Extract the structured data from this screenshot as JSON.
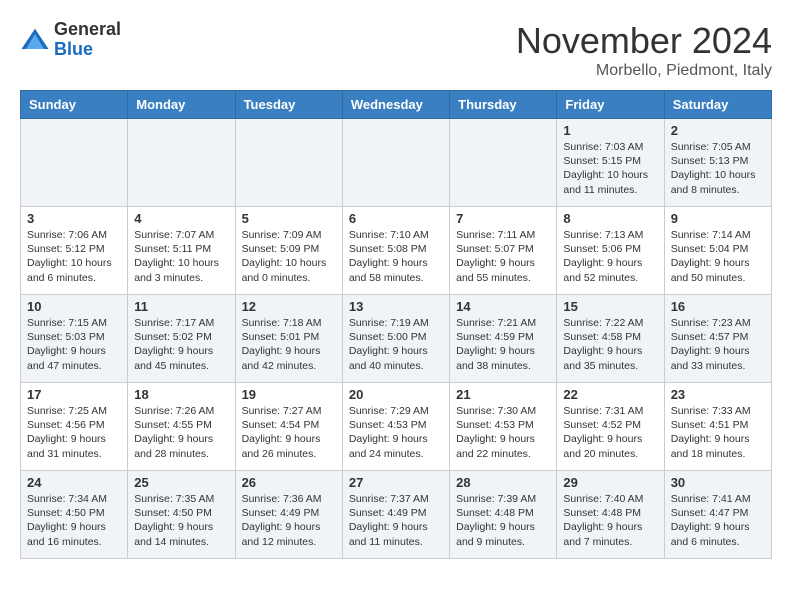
{
  "header": {
    "logo_line1": "General",
    "logo_line2": "Blue",
    "month_title": "November 2024",
    "location": "Morbello, Piedmont, Italy"
  },
  "weekdays": [
    "Sunday",
    "Monday",
    "Tuesday",
    "Wednesday",
    "Thursday",
    "Friday",
    "Saturday"
  ],
  "weeks": [
    [
      {
        "day": "",
        "info": ""
      },
      {
        "day": "",
        "info": ""
      },
      {
        "day": "",
        "info": ""
      },
      {
        "day": "",
        "info": ""
      },
      {
        "day": "",
        "info": ""
      },
      {
        "day": "1",
        "info": "Sunrise: 7:03 AM\nSunset: 5:15 PM\nDaylight: 10 hours and 11 minutes."
      },
      {
        "day": "2",
        "info": "Sunrise: 7:05 AM\nSunset: 5:13 PM\nDaylight: 10 hours and 8 minutes."
      }
    ],
    [
      {
        "day": "3",
        "info": "Sunrise: 7:06 AM\nSunset: 5:12 PM\nDaylight: 10 hours and 6 minutes."
      },
      {
        "day": "4",
        "info": "Sunrise: 7:07 AM\nSunset: 5:11 PM\nDaylight: 10 hours and 3 minutes."
      },
      {
        "day": "5",
        "info": "Sunrise: 7:09 AM\nSunset: 5:09 PM\nDaylight: 10 hours and 0 minutes."
      },
      {
        "day": "6",
        "info": "Sunrise: 7:10 AM\nSunset: 5:08 PM\nDaylight: 9 hours and 58 minutes."
      },
      {
        "day": "7",
        "info": "Sunrise: 7:11 AM\nSunset: 5:07 PM\nDaylight: 9 hours and 55 minutes."
      },
      {
        "day": "8",
        "info": "Sunrise: 7:13 AM\nSunset: 5:06 PM\nDaylight: 9 hours and 52 minutes."
      },
      {
        "day": "9",
        "info": "Sunrise: 7:14 AM\nSunset: 5:04 PM\nDaylight: 9 hours and 50 minutes."
      }
    ],
    [
      {
        "day": "10",
        "info": "Sunrise: 7:15 AM\nSunset: 5:03 PM\nDaylight: 9 hours and 47 minutes."
      },
      {
        "day": "11",
        "info": "Sunrise: 7:17 AM\nSunset: 5:02 PM\nDaylight: 9 hours and 45 minutes."
      },
      {
        "day": "12",
        "info": "Sunrise: 7:18 AM\nSunset: 5:01 PM\nDaylight: 9 hours and 42 minutes."
      },
      {
        "day": "13",
        "info": "Sunrise: 7:19 AM\nSunset: 5:00 PM\nDaylight: 9 hours and 40 minutes."
      },
      {
        "day": "14",
        "info": "Sunrise: 7:21 AM\nSunset: 4:59 PM\nDaylight: 9 hours and 38 minutes."
      },
      {
        "day": "15",
        "info": "Sunrise: 7:22 AM\nSunset: 4:58 PM\nDaylight: 9 hours and 35 minutes."
      },
      {
        "day": "16",
        "info": "Sunrise: 7:23 AM\nSunset: 4:57 PM\nDaylight: 9 hours and 33 minutes."
      }
    ],
    [
      {
        "day": "17",
        "info": "Sunrise: 7:25 AM\nSunset: 4:56 PM\nDaylight: 9 hours and 31 minutes."
      },
      {
        "day": "18",
        "info": "Sunrise: 7:26 AM\nSunset: 4:55 PM\nDaylight: 9 hours and 28 minutes."
      },
      {
        "day": "19",
        "info": "Sunrise: 7:27 AM\nSunset: 4:54 PM\nDaylight: 9 hours and 26 minutes."
      },
      {
        "day": "20",
        "info": "Sunrise: 7:29 AM\nSunset: 4:53 PM\nDaylight: 9 hours and 24 minutes."
      },
      {
        "day": "21",
        "info": "Sunrise: 7:30 AM\nSunset: 4:53 PM\nDaylight: 9 hours and 22 minutes."
      },
      {
        "day": "22",
        "info": "Sunrise: 7:31 AM\nSunset: 4:52 PM\nDaylight: 9 hours and 20 minutes."
      },
      {
        "day": "23",
        "info": "Sunrise: 7:33 AM\nSunset: 4:51 PM\nDaylight: 9 hours and 18 minutes."
      }
    ],
    [
      {
        "day": "24",
        "info": "Sunrise: 7:34 AM\nSunset: 4:50 PM\nDaylight: 9 hours and 16 minutes."
      },
      {
        "day": "25",
        "info": "Sunrise: 7:35 AM\nSunset: 4:50 PM\nDaylight: 9 hours and 14 minutes."
      },
      {
        "day": "26",
        "info": "Sunrise: 7:36 AM\nSunset: 4:49 PM\nDaylight: 9 hours and 12 minutes."
      },
      {
        "day": "27",
        "info": "Sunrise: 7:37 AM\nSunset: 4:49 PM\nDaylight: 9 hours and 11 minutes."
      },
      {
        "day": "28",
        "info": "Sunrise: 7:39 AM\nSunset: 4:48 PM\nDaylight: 9 hours and 9 minutes."
      },
      {
        "day": "29",
        "info": "Sunrise: 7:40 AM\nSunset: 4:48 PM\nDaylight: 9 hours and 7 minutes."
      },
      {
        "day": "30",
        "info": "Sunrise: 7:41 AM\nSunset: 4:47 PM\nDaylight: 9 hours and 6 minutes."
      }
    ]
  ]
}
